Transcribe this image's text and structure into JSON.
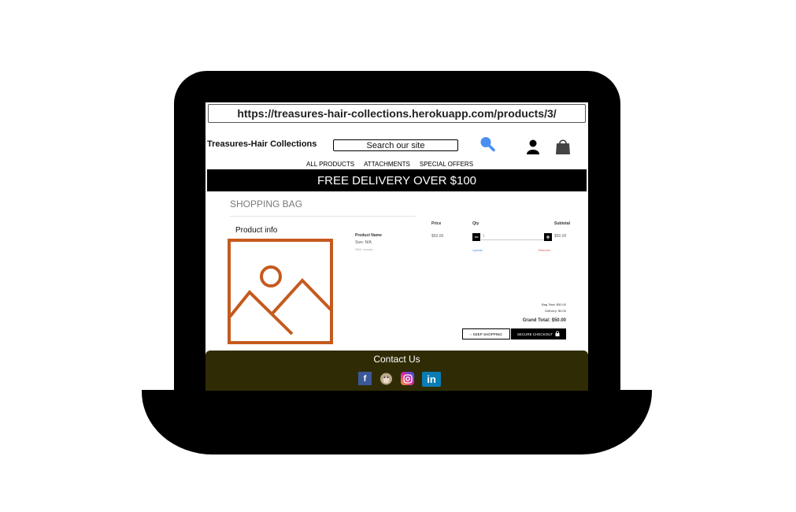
{
  "browser": {
    "url": "https://treasures-hair-collections.herokuapp.com/products/3/"
  },
  "header": {
    "brand": "Treasures-Hair Collections",
    "search_placeholder": "Search our site",
    "icons": [
      "search-icon",
      "user-icon",
      "shopping-bag-icon"
    ]
  },
  "nav": {
    "items": [
      "ALL PRODUCTS",
      "ATTACHMENTS",
      "SPECIAL OFFERS"
    ]
  },
  "banner": {
    "text": "FREE DELIVERY OVER $100"
  },
  "bag": {
    "title": "SHOPPING BAG",
    "columns": {
      "product": "Product info",
      "price": "Price",
      "qty": "Qty",
      "subtotal": "Subtotal"
    },
    "item": {
      "name": "Product Name",
      "size": "Size: N/A",
      "sku": "SKU: xxxxxx",
      "price": "$50.00",
      "qty": "1",
      "subtotal": "$50.00",
      "update": "Update",
      "remove": "Remove"
    },
    "totals": {
      "bag_total": "Bag Total: $50.00",
      "delivery": "Delivery: $0.00",
      "grand_total": "Grand Total: $50.00"
    },
    "buttons": {
      "keep_shopping": "KEEP SHOPPING",
      "secure_checkout": "SECURE CHECKOUT"
    }
  },
  "footer": {
    "heading": "Contact Us",
    "socials": [
      "facebook-icon",
      "github-icon",
      "instagram-icon",
      "linkedin-icon"
    ]
  },
  "colors": {
    "accent": "#4a8ef0",
    "placeholder_orange": "#c55a1e",
    "footer_bg": "#2f2c05"
  }
}
